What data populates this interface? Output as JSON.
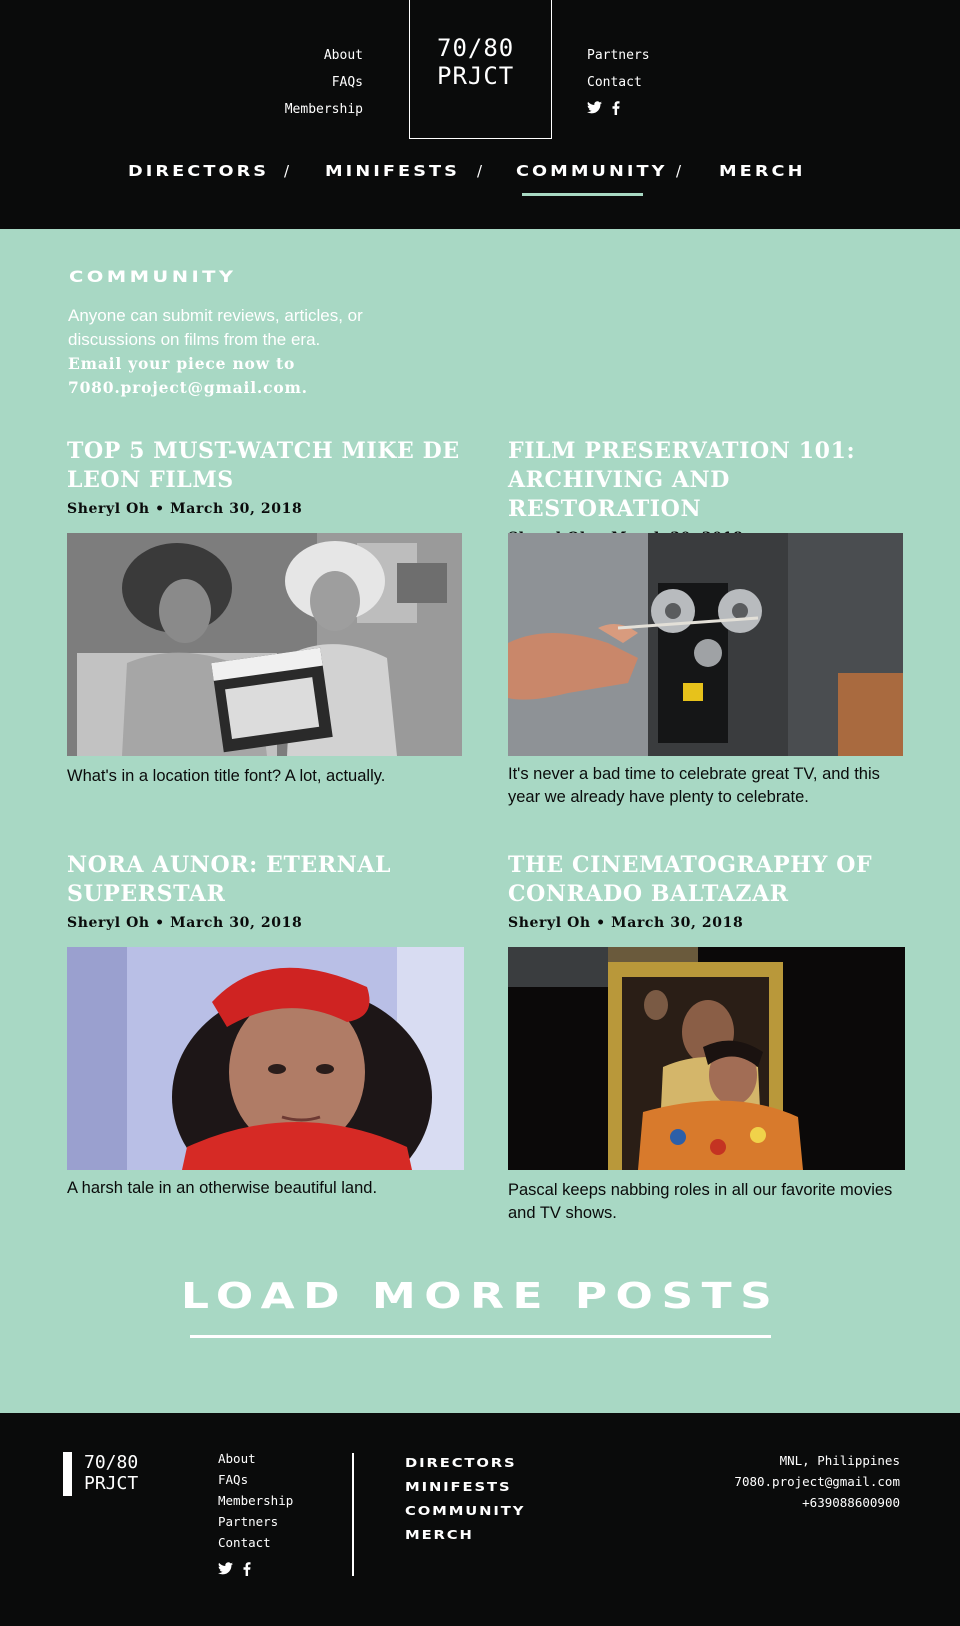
{
  "header": {
    "logo_line1": "70/80",
    "logo_line2": "PRJCT",
    "left_links": [
      "About",
      "FAQs",
      "Membership"
    ],
    "right_links": [
      "Partners",
      "Contact"
    ],
    "social_icons": [
      "twitter-icon",
      "facebook-icon"
    ]
  },
  "nav": {
    "items": [
      "DIRECTORS",
      "MINIFESTS",
      "COMMUNITY",
      "MERCH"
    ],
    "separator": "/",
    "active": "COMMUNITY"
  },
  "main": {
    "section_title": "COMMUNITY",
    "intro": "Anyone can submit reviews, articles, or discussions on films from the era.",
    "intro_cta": "Email your piece now to 7080.project@gmail.com.",
    "posts": [
      {
        "title": "Top 5 Must-Watch Mike De Leon Films",
        "meta": "Sheryl Oh • March 30, 2018",
        "excerpt": "What's in a location title font? A lot, actually."
      },
      {
        "title": "Film Preservation 101: Archiving and Restoration",
        "meta": "Sheryl Oh • March 30, 2018",
        "excerpt": "It's never a bad time to celebrate great TV, and this year we already have plenty to celebrate."
      },
      {
        "title": "Nora Aunor: Eternal Superstar",
        "meta": "Sheryl Oh • March 30, 2018",
        "excerpt": "A harsh tale in an otherwise beautiful land."
      },
      {
        "title": "The Cinematography of Conrado Baltazar",
        "meta": "Sheryl Oh • March 30, 2018",
        "excerpt": "Pascal keeps nabbing roles in all our favorite movies and TV shows."
      }
    ],
    "load_more": "LOAD MORE POSTS"
  },
  "footer": {
    "logo_line1": "70/80",
    "logo_line2": "PRJCT",
    "links": [
      "About",
      "FAQs",
      "Membership",
      "Partners",
      "Contact"
    ],
    "nav": [
      "DIRECTORS",
      "MINIFESTS",
      "COMMUNITY",
      "MERCH"
    ],
    "location": "MNL, Philippines",
    "email": "7080.project@gmail.com",
    "phone": "+639088600900"
  },
  "colors": {
    "background_dark": "#0a0b0b",
    "mint": "#a8d8c4",
    "text_light": "#ffffff",
    "text_dark": "#0a0b0b"
  }
}
